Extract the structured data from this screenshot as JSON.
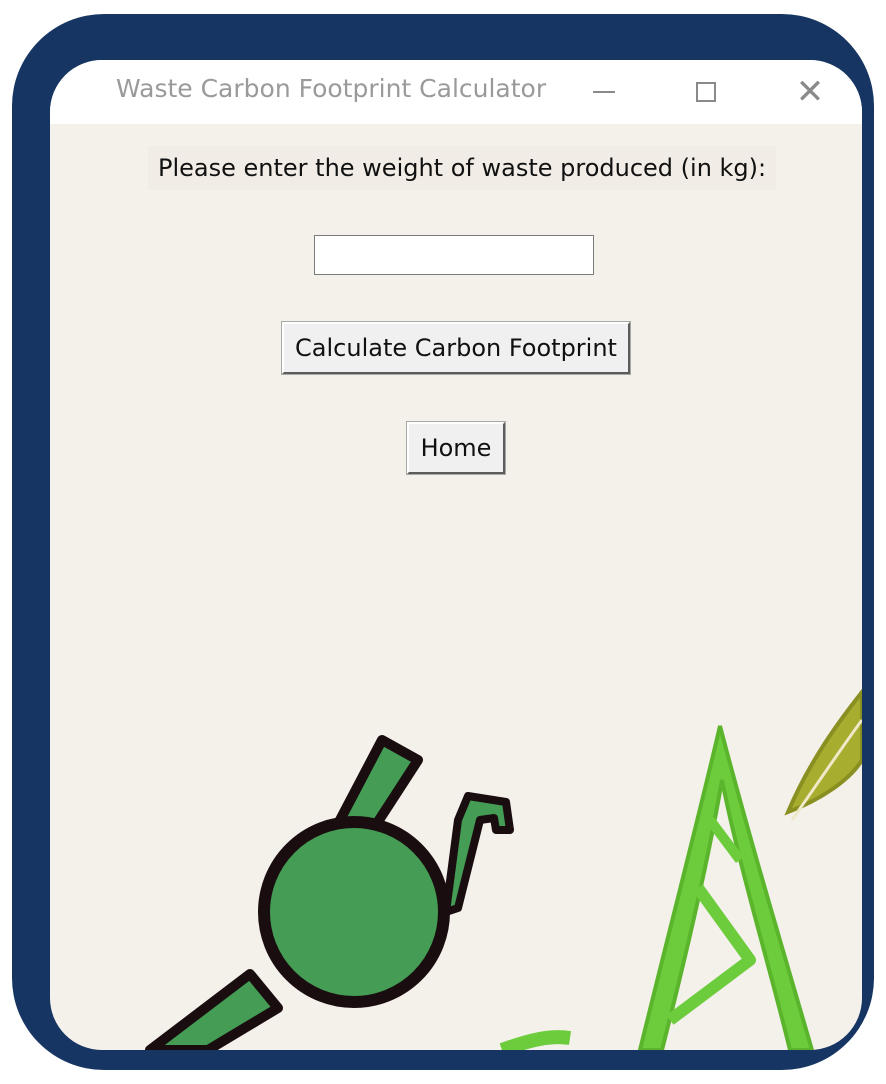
{
  "window": {
    "title": "Waste Carbon Footprint Calculator",
    "controls": {
      "minimize": "minimize-icon",
      "maximize": "maximize-icon",
      "close": "close-icon",
      "close_glyph": "✕"
    }
  },
  "form": {
    "prompt_label": "Please enter the weight of waste produced (in kg):",
    "weight_input_value": "",
    "calculate_button_label": "Calculate Carbon Footprint",
    "home_button_label": "Home"
  },
  "colors": {
    "frame": "#163562",
    "window_background": "#f4f0ea",
    "illustration_green": "#449c55",
    "illustration_lime": "#6dcc3c",
    "illustration_olive": "#a7ad2e"
  }
}
